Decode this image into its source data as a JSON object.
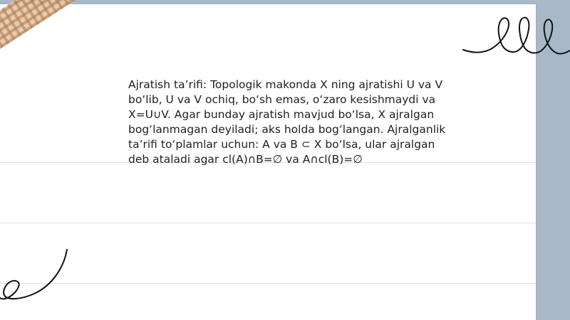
{
  "slide": {
    "text": "Ajratish taʼrifi: Topologik makonda X ning ajratishi U va V boʻlib, U va V ochiq, boʻsh emas, oʻzaro kesishmaydi va X=U∪V. Agar bunday ajratish mavjud boʻlsa, X ajralgan bogʻlanmagan deyiladi; aks holda bogʻlangan. Ajralganlik taʼrifi toʻplamlar uchun: A va B ⊂ X boʻlsa, ular ajralgan deb ataladi agar cl(A)∩B=∅ va A∩cl(B)=∅"
  },
  "decor": {
    "background_color": "#a9b8c8",
    "paper_color": "#ffffff",
    "tape_color": "#e7c9a8",
    "ink_color": "#111111",
    "icons": [
      "washi-tape-icon",
      "loop-scribble-icon",
      "curl-scribble-icon"
    ]
  }
}
